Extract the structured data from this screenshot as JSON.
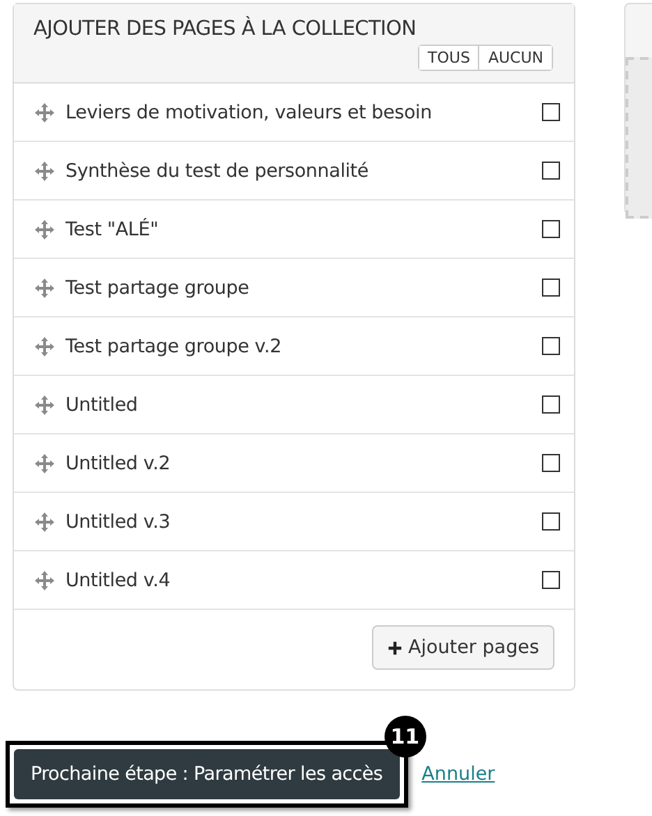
{
  "panel": {
    "title": "AJOUTER DES PAGES À LA COLLECTION",
    "select_buttons": [
      "TOUS",
      "AUCUN"
    ],
    "pages": [
      {
        "label": "Leviers de motivation, valeurs et besoin",
        "checked": false
      },
      {
        "label": "Synthèse du test de personnalité",
        "checked": false
      },
      {
        "label": "Test \"ALÉ\"",
        "checked": false
      },
      {
        "label": "Test partage groupe",
        "checked": false
      },
      {
        "label": "Test partage groupe v.2",
        "checked": false
      },
      {
        "label": "Untitled",
        "checked": false
      },
      {
        "label": "Untitled v.2",
        "checked": false
      },
      {
        "label": "Untitled v.3",
        "checked": false
      },
      {
        "label": "Untitled v.4",
        "checked": false
      }
    ],
    "add_button": "Ajouter pages"
  },
  "next_button": "Prochaine étape : Paramétrer les accès",
  "step_badge": "11",
  "cancel_link": "Annuler"
}
